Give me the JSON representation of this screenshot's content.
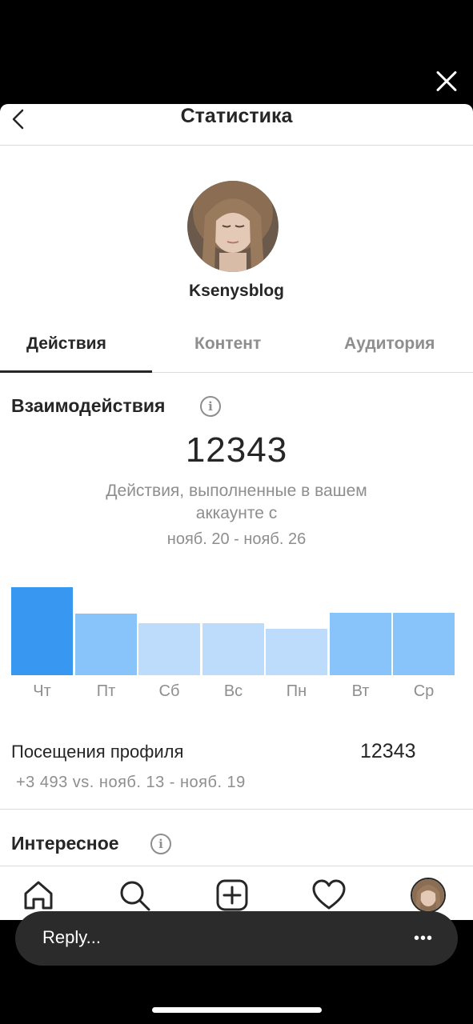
{
  "header": {
    "title": "Статистика"
  },
  "profile": {
    "username": "Ksenysblog"
  },
  "tabs": [
    {
      "label": "Действия",
      "active": true
    },
    {
      "label": "Контент",
      "active": false
    },
    {
      "label": "Аудитория",
      "active": false
    }
  ],
  "interactions": {
    "title": "Взаимодействия",
    "total": "12343",
    "subtitle": "Действия, выполненные в вашем аккаунте с",
    "date_range": "нояб. 20 - нояб. 26"
  },
  "chart_data": {
    "type": "bar",
    "categories": [
      "Чт",
      "Пт",
      "Сб",
      "Вс",
      "Пн",
      "Вт",
      "Ср"
    ],
    "values": [
      110,
      77,
      65,
      65,
      58,
      78,
      78
    ],
    "highlighted_index": 0,
    "colors": {
      "highlight": "#3897f0",
      "high": "#88c3fa",
      "low": "#bddcfb"
    }
  },
  "profile_visits": {
    "label": "Посещения профиля",
    "value": "12343",
    "comparison": "+3 493 vs. нояб. 13 - нояб. 19"
  },
  "discovery": {
    "title": "Интересное"
  },
  "bottom_nav": [
    {
      "icon": "home-icon"
    },
    {
      "icon": "search-icon"
    },
    {
      "icon": "add-post-icon"
    },
    {
      "icon": "heart-icon"
    },
    {
      "icon": "profile-avatar"
    }
  ],
  "reply": {
    "placeholder": "Reply..."
  },
  "colors": {
    "accent": "#3897f0",
    "text": "#262626",
    "secondary": "#8e8e8e",
    "divider": "#dbdbdb"
  }
}
